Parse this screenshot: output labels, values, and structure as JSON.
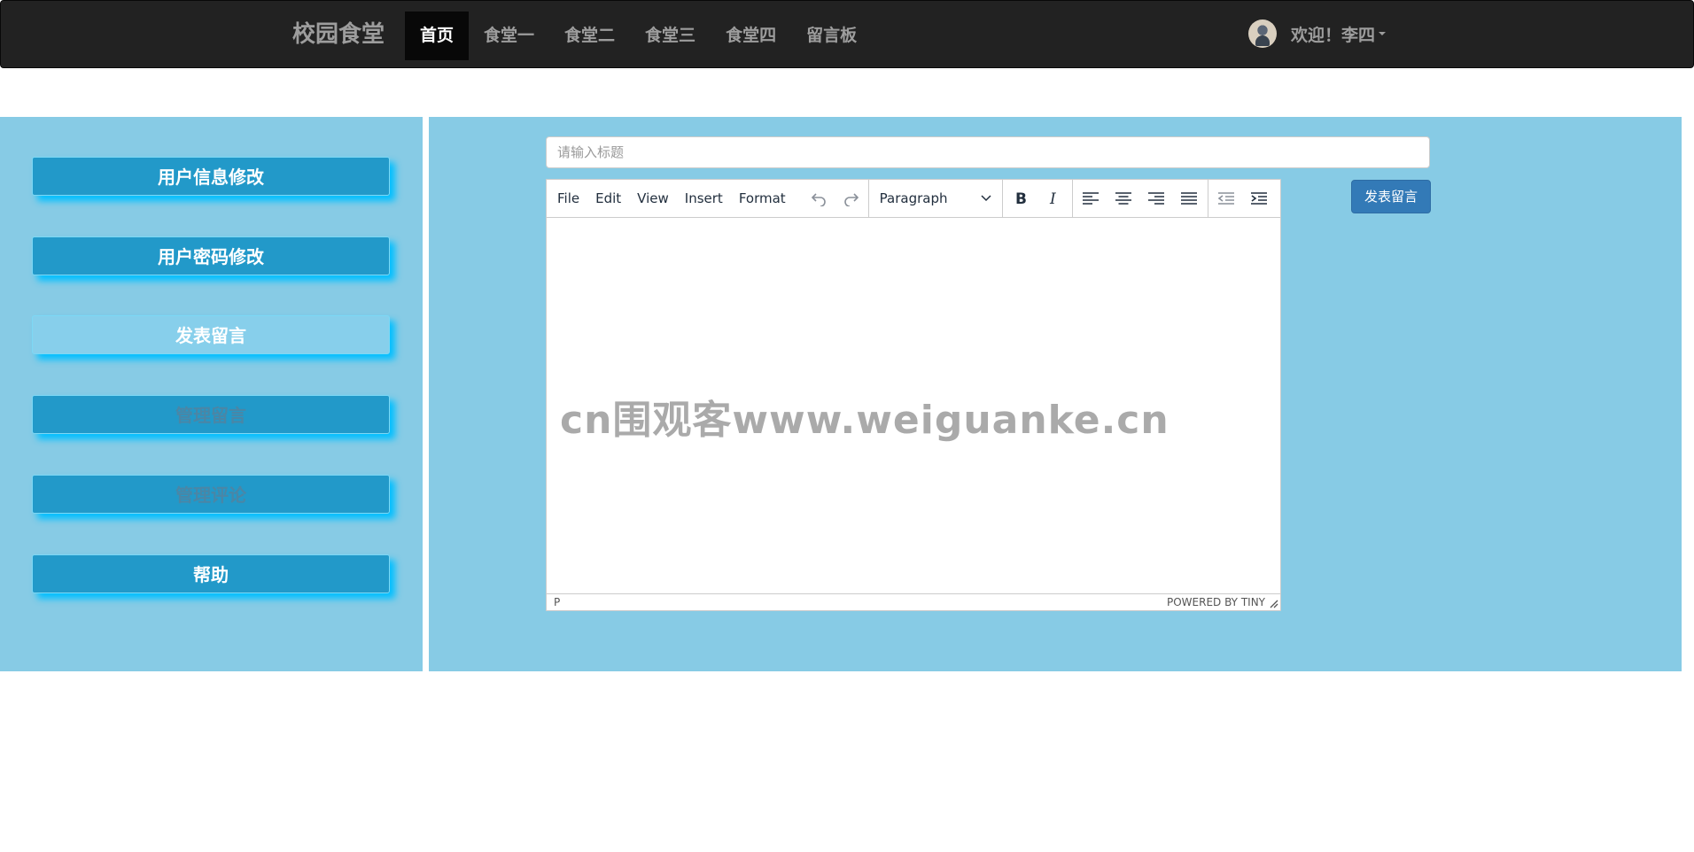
{
  "navbar": {
    "brand": "校园食堂",
    "items": [
      {
        "label": "首页"
      },
      {
        "label": "食堂一"
      },
      {
        "label": "食堂二"
      },
      {
        "label": "食堂三"
      },
      {
        "label": "食堂四"
      },
      {
        "label": "留言板"
      }
    ],
    "user_greeting": "欢迎！李四"
  },
  "sidebar": {
    "items": [
      {
        "label": "用户信息修改"
      },
      {
        "label": "用户密码修改"
      },
      {
        "label": "发表留言"
      },
      {
        "label": "管理留言"
      },
      {
        "label": "管理评论"
      },
      {
        "label": "帮助"
      }
    ]
  },
  "main": {
    "title_placeholder": "请输入标题",
    "post_button": "发表留言",
    "editor": {
      "menus": [
        "File",
        "Edit",
        "View",
        "Insert",
        "Format"
      ],
      "block_format": "Paragraph",
      "status_path": "P",
      "powered_by": "POWERED BY TINY"
    }
  },
  "watermark": "cn围观客www.weiguanke.cn",
  "colors": {
    "navbar_bg": "#222222",
    "panel_bg": "#87cbe5",
    "sidebar_button": "#2299c9",
    "sidebar_button_active": "#87cfeb",
    "primary_button": "#337ab7"
  }
}
